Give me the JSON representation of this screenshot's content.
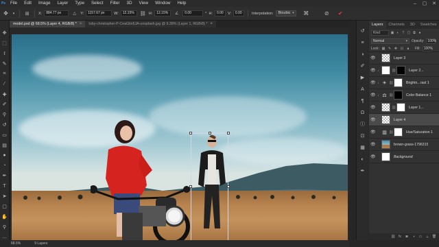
{
  "menu": [
    "File",
    "Edit",
    "Image",
    "Layer",
    "Type",
    "Select",
    "Filter",
    "3D",
    "View",
    "Window",
    "Help"
  ],
  "options": {
    "x_label": "X:",
    "x_value": "884.77 px",
    "y_label": "Y:",
    "y_value": "1157.67 px",
    "w_label": "W:",
    "w_value": "12.15%",
    "h_label": "H:",
    "h_value": "12.15%",
    "angle_value": "0.00",
    "hskew_label": "H:",
    "hskew_value": "0.00",
    "vskew_label": "V:",
    "vskew_value": "0.00",
    "interpolation_label": "Interpolation:",
    "interpolation_value": "Bicubic"
  },
  "tabs": [
    {
      "label": "model.psd @ 68.5% (Layer 4, RGB/8) *",
      "active": true
    },
    {
      "label": "toby-christopher-P-CeaGlin5JA-unsplash.jpg @ 9.38% (Layer 1, RGB/8) *",
      "active": false
    }
  ],
  "status": {
    "zoom": "68.5%",
    "doc_info": "9 Layers"
  },
  "layers_panel": {
    "tabs": [
      "Layers",
      "Channels",
      "3D",
      "Swatches"
    ],
    "kind_label": "Kind",
    "blend_mode": "Normal",
    "opacity_label": "Opacity:",
    "opacity_value": "100%",
    "lock_label": "Lock:",
    "fill_label": "Fill:",
    "fill_value": "100%",
    "layers": [
      {
        "name": "Layer 3",
        "thumb": "checker",
        "mask": null,
        "adj": null,
        "selected": false,
        "italic": false
      },
      {
        "name": "Layer 2...",
        "thumb": "white",
        "mask": "black",
        "adj": null,
        "selected": false,
        "italic": false
      },
      {
        "name": "Brightn...rast 1",
        "thumb": null,
        "mask": "white",
        "adj": "brightness-icon",
        "selected": false,
        "italic": false
      },
      {
        "name": "Color Balance 1",
        "thumb": null,
        "mask": "black",
        "adj": "color-balance-icon",
        "selected": false,
        "italic": false
      },
      {
        "name": "Layer 1...",
        "thumb": "checker",
        "mask": "white",
        "adj": null,
        "selected": false,
        "italic": false
      },
      {
        "name": "Layer 4",
        "thumb": "checker",
        "mask": null,
        "adj": null,
        "selected": true,
        "italic": false
      },
      {
        "name": "Hue/Saturation 1",
        "thumb": null,
        "mask": "white",
        "adj": "hue-saturation-icon",
        "selected": false,
        "italic": false
      },
      {
        "name": "brown-grass-1796315",
        "thumb": "land",
        "mask": null,
        "adj": null,
        "selected": false,
        "italic": false
      },
      {
        "name": "Background",
        "thumb": "white",
        "mask": null,
        "adj": null,
        "selected": false,
        "italic": true
      }
    ]
  }
}
